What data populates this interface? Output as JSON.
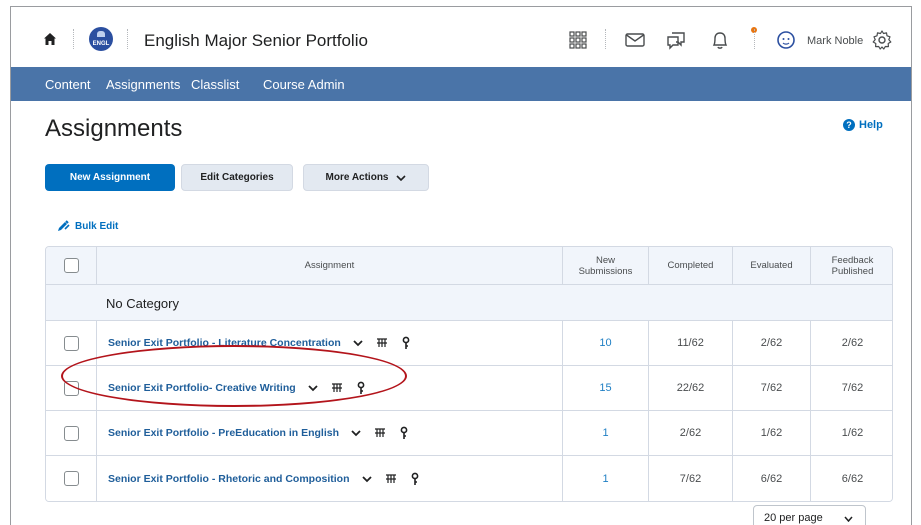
{
  "topbar": {
    "course_title": "English Major Senior Portfolio",
    "org_logo_text": "ENGL",
    "user_name": "Mark Noble",
    "icons": [
      "home-icon",
      "grid-icon",
      "mail-icon",
      "chat-icon",
      "bell-icon",
      "user-avatar-icon",
      "gear-icon"
    ]
  },
  "navbar": {
    "items": [
      "Content",
      "Assignments",
      "Classlist",
      "Course Admin"
    ]
  },
  "page": {
    "title": "Assignments",
    "help_label": "Help",
    "buttons": {
      "new_assignment": "New Assignment",
      "edit_categories": "Edit Categories",
      "more_actions": "More Actions"
    },
    "bulk_edit_label": "Bulk Edit"
  },
  "table": {
    "headers": {
      "assignment": "Assignment",
      "new_submissions_1": "New",
      "new_submissions_2": "Submissions",
      "completed": "Completed",
      "evaluated": "Evaluated",
      "feedback_1": "Feedback",
      "feedback_2": "Published"
    },
    "category": "No Category",
    "rows": [
      {
        "name": "Senior Exit Portfolio - Literature Concentration",
        "new": "10",
        "completed": "11/62",
        "evaluated": "2/62",
        "feedback": "2/62"
      },
      {
        "name": "Senior Exit Portfolio- Creative Writing",
        "new": "15",
        "completed": "22/62",
        "evaluated": "7/62",
        "feedback": "7/62"
      },
      {
        "name": "Senior Exit Portfolio - PreEducation in English",
        "new": "1",
        "completed": "2/62",
        "evaluated": "1/62",
        "feedback": "1/62"
      },
      {
        "name": "Senior Exit Portfolio - Rhetoric and Composition",
        "new": "1",
        "completed": "7/62",
        "evaluated": "6/62",
        "feedback": "6/62"
      }
    ]
  },
  "pager": {
    "per_page": "20 per page"
  },
  "colors": {
    "navbar": "#4a74a8",
    "primary": "#006fbf",
    "highlight": "#b3141b"
  }
}
